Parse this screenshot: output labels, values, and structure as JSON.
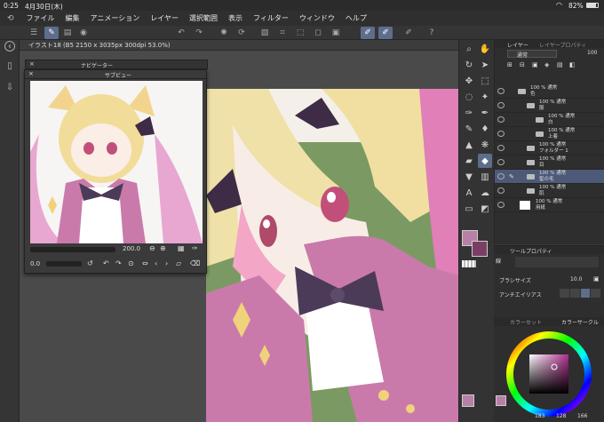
{
  "status": {
    "time": "0:25",
    "date": "4月30日(木)",
    "battery": "82%"
  },
  "menu": [
    "ファイル",
    "編集",
    "アニメーション",
    "レイヤー",
    "選択範囲",
    "表示",
    "フィルター",
    "ウィンドウ",
    "ヘルプ"
  ],
  "document": {
    "tab_label": "イラスト18 (B5 2150 x 3035px 300dpi 53.0%)"
  },
  "navigator": {
    "title": "ナビゲーター",
    "sub_title": "サブビュー",
    "zoom_value": "200.0",
    "rotate_value": "0.0"
  },
  "layers": {
    "tab_layer": "レイヤー",
    "tab_property": "レイヤープロパティ",
    "blend_mode": "通常",
    "opacity": "100",
    "rows": [
      {
        "line1": "100 % 通常",
        "line2": "色"
      },
      {
        "line1": "100 % 通常",
        "line2": "服"
      },
      {
        "line1": "100 % 通常",
        "line2": "白"
      },
      {
        "line1": "100 % 通常",
        "line2": "上着"
      },
      {
        "line1": "100 % 通常",
        "line2": "フォルダー 1"
      },
      {
        "line1": "100 % 通常",
        "line2": "目"
      },
      {
        "line1": "100 % 通常",
        "line2": "髪の毛"
      },
      {
        "line1": "100 % 通常",
        "line2": "肌"
      },
      {
        "line1": "100 % 通常",
        "line2": "用紙"
      }
    ]
  },
  "tool_property": {
    "title": "ツールプロパティ",
    "tool_name": "線",
    "brush_size_label": "ブラシサイズ",
    "brush_size_value": "10.0",
    "antialias_label": "アンチエイリアス"
  },
  "color": {
    "tab_color_set": "カラーセット",
    "tab_color_circle": "カラーサークル",
    "rgb": [
      "183",
      "128",
      "166"
    ],
    "main_color": "#b780a6",
    "sub_color": "#7a3e66"
  },
  "icons": {
    "left_rail": [
      "back-icon",
      "settings-icon",
      "document-icon",
      "import-icon"
    ],
    "tools": [
      "zoom-icon",
      "hand-icon",
      "rotate-icon",
      "operation-icon",
      "move-icon",
      "select-icon",
      "lasso-icon",
      "magic-wand-icon",
      "eyedropper-icon",
      "pen-icon",
      "pencil-icon",
      "brush-icon",
      "airbrush-icon",
      "decorate-icon",
      "eraser-icon",
      "blend-icon",
      "fill-icon",
      "gradient-icon",
      "figure-icon",
      "frame-icon",
      "text-icon",
      "balloon-icon",
      "ruler-icon",
      "correction-icon"
    ]
  }
}
